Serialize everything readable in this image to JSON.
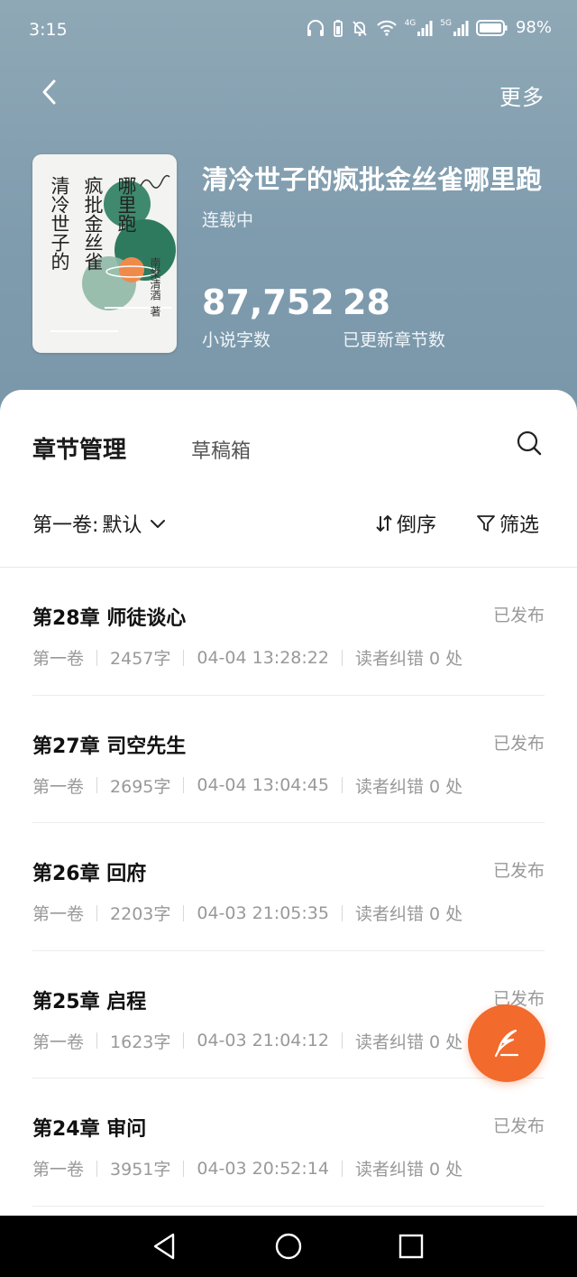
{
  "status_bar": {
    "time": "3:15",
    "network_4g": "4G",
    "network_5g": "5G",
    "battery": "98%"
  },
  "nav": {
    "back_icon": "chevron-left-icon",
    "more_label": "更多"
  },
  "book": {
    "cover": {
      "title_columns": [
        "清冷世子的",
        "疯批金丝雀",
        "哪里跑"
      ],
      "author_vertical": "南棠清酒",
      "author_suffix": "著"
    },
    "title": "清冷世子的疯批金丝雀哪里跑",
    "status": "连载中",
    "word_count": "87,752",
    "word_count_label": "小说字数",
    "chapter_count": "28",
    "chapter_count_label": "已更新章节数"
  },
  "panel": {
    "tab_manage": "章节管理",
    "tab_drafts": "草稿箱",
    "volume_prefix": "第一卷:",
    "volume_value": "默认",
    "sort_label": "倒序",
    "filter_label": "筛选"
  },
  "chapters": [
    {
      "title": "第28章 师徒谈心",
      "status": "已发布",
      "volume": "第一卷",
      "words": "2457字",
      "time": "04-04 13:28:22",
      "errors": "读者纠错 0 处"
    },
    {
      "title": "第27章 司空先生",
      "status": "已发布",
      "volume": "第一卷",
      "words": "2695字",
      "time": "04-04 13:04:45",
      "errors": "读者纠错 0 处"
    },
    {
      "title": "第26章 回府",
      "status": "已发布",
      "volume": "第一卷",
      "words": "2203字",
      "time": "04-03 21:05:35",
      "errors": "读者纠错 0 处"
    },
    {
      "title": "第25章 启程",
      "status": "已发布",
      "volume": "第一卷",
      "words": "1623字",
      "time": "04-03 21:04:12",
      "errors": "读者纠错 0 处"
    },
    {
      "title": "第24章 审问",
      "status": "已发布",
      "volume": "第一卷",
      "words": "3951字",
      "time": "04-03 20:52:14",
      "errors": "读者纠错 0 处"
    }
  ],
  "colors": {
    "header_bg": "#7f9cae",
    "accent": "#f26a2c",
    "muted_text": "#999999"
  },
  "fab_icon": "quill-write-icon"
}
